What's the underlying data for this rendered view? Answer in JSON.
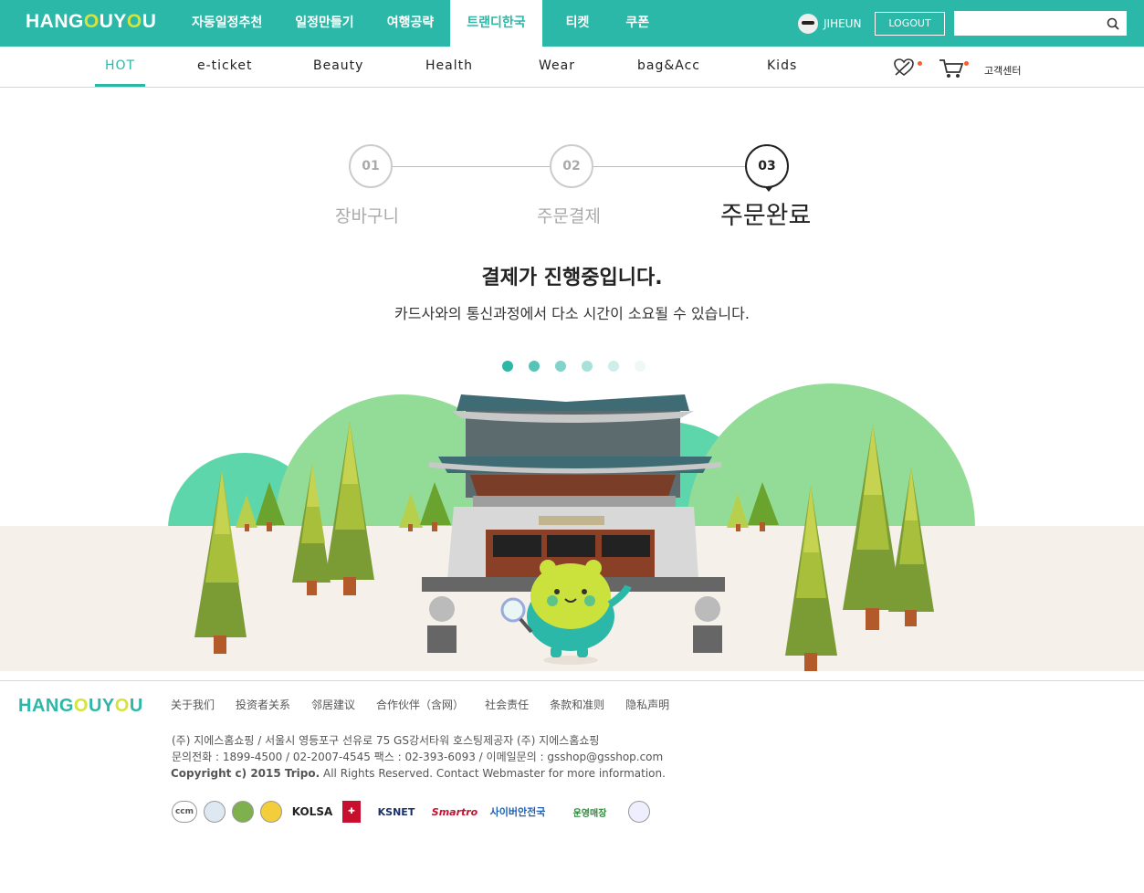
{
  "header": {
    "logo_pre": "HANG",
    "logo_o1": "O",
    "logo_mid": "UY",
    "logo_o2": "O",
    "logo_post": "U",
    "nav": [
      {
        "label": "자동일정추천"
      },
      {
        "label": "일정만들기"
      },
      {
        "label": "여행공략"
      },
      {
        "label": "트랜디한국",
        "active": true
      },
      {
        "label": "티켓"
      },
      {
        "label": "쿠폰"
      }
    ],
    "username": "JIHEUN",
    "logout_label": "LOGOUT",
    "search_placeholder": ""
  },
  "subnav": {
    "categories": [
      "HOT",
      "e-ticket",
      "Beauty",
      "Health",
      "Wear",
      "bag&Acc",
      "Kids"
    ],
    "active": "HOT",
    "customer_center": "고객센터"
  },
  "steps": [
    {
      "number": "01",
      "label": "장바구니"
    },
    {
      "number": "02",
      "label": "주문결제"
    },
    {
      "number": "03",
      "label": "주문완료",
      "active": true
    }
  ],
  "message": {
    "title": "결제가 진행중입니다.",
    "subtitle": "카드사와의 통신과정에서 다소 시간이 소요될 수 있습니다."
  },
  "loading_dots": [
    "#2cb8a8",
    "#55c4b7",
    "#82d3c9",
    "#a8e1d9",
    "#cdeee9",
    "#eef8f6"
  ],
  "footer": {
    "links": [
      "关于我们",
      "投资者关系",
      "邻居建议",
      "合作伙伴（含网）",
      "社会责任",
      "条款和准则",
      "隐私声明"
    ],
    "info_line1": "(주) 지에스홈쇼핑  / 서울시 영등포구 선유로 75 GS강서타워 호스팅제공자 (주) 지에스홈쇼핑",
    "info_line2": "문의전화 : 1899-4500 / 02-2007-4545 팩스 : 02-393-6093 / 이메일문의 : gsshop@gsshop.com",
    "copyright_bold": "Copyright c) 2015 Tripo.",
    "copyright_rest": " All Rights Reserved. Contact Webmaster for more information.",
    "badges": [
      "ccm",
      "",
      "",
      "",
      "KOLSA",
      "",
      "KSNET",
      "Smartro",
      "사이버안전국",
      "운영매장",
      ""
    ]
  },
  "colors": {
    "brand": "#2cb8a8",
    "logo_accent": "#d6e33b",
    "notify": "#ff5a2b"
  }
}
